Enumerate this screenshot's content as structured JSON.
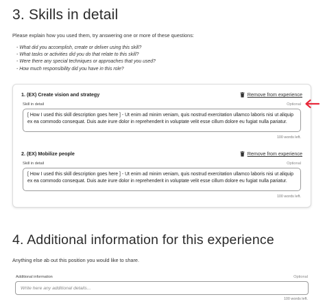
{
  "section3": {
    "title": "3. Skills in detail",
    "intro": "Please explain how you used them, try answering one or more of these questions:",
    "questions": [
      "- What did you accomplish, create or deliver using this skill?",
      "- What tasks or activities did you do that relate to this skill?",
      "- Were there any special techniques or approaches that you used?",
      "- How much responsibility did you have in this role?"
    ]
  },
  "skills": [
    {
      "title": "1. (EX) Create vision and strategy",
      "remove_label": "Remove from experience",
      "field_label": "Skill in detail",
      "optional_label": "Optional",
      "text": "[ How I used this skill description goes here ] - Ut enim ad minim veniam, quis nostrud exercitation ullamco laboris nisi ut aliquip ex ea commodo consequat. Duis aute irure dolor in reprehenderit in voluptate velit esse cillum dolore eu fugiat nulla pariatur.",
      "counter": "100 words left."
    },
    {
      "title": "2. (EX) Mobilize people",
      "remove_label": "Remove from experience",
      "field_label": "Skill in detail",
      "optional_label": "Optional",
      "text": "[ How I used this skill description goes here ] - Ut enim ad minim veniam, quis nostrud exercitation ullamco laboris nisi ut aliquip ex ea commodo consequat. Duis aute irure dolor in reprehenderit in voluptate velit esse cillum dolore eu fugiat nulla pariatur.",
      "counter": "100 words left."
    }
  ],
  "section4": {
    "title": "4. Additional information for this experience",
    "intro": "Anything else ab out this position you would like to share.",
    "field_label": "Additional information",
    "optional_label": "Optional",
    "placeholder": "Write here any additional details...",
    "counter": "100 words left."
  },
  "colors": {
    "annotation_arrow": "#e8283a"
  },
  "icons": {
    "remove": "trash-icon",
    "annotation": "arrow-left-icon"
  }
}
